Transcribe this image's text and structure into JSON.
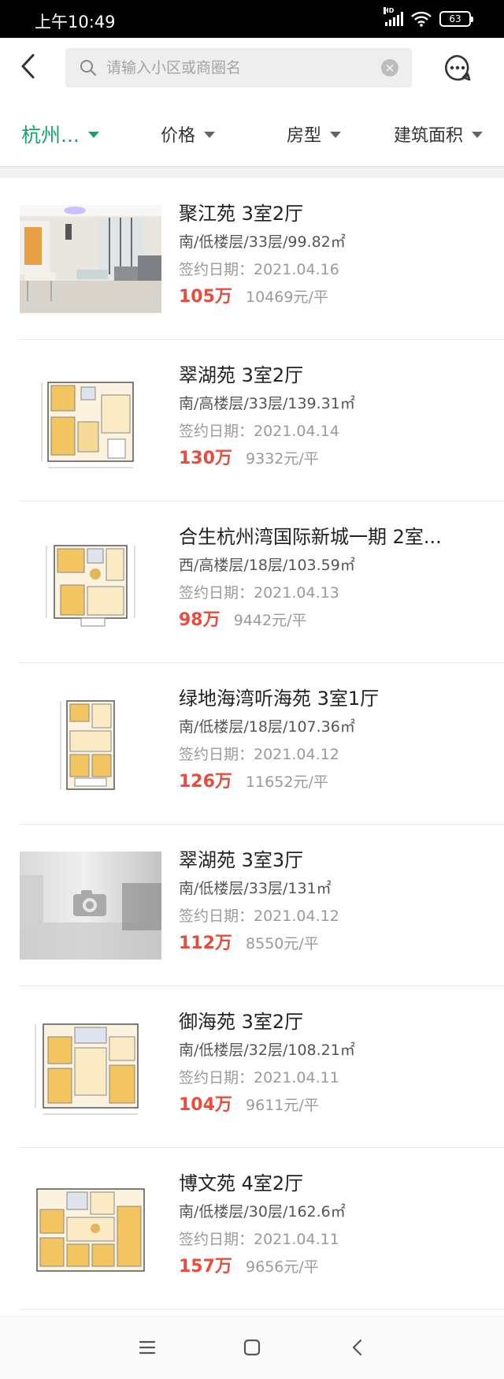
{
  "status_bar": {
    "time": "上午10:49",
    "hd": "HD",
    "battery": "63"
  },
  "search": {
    "placeholder": "请输入小区或商圈名"
  },
  "filters": [
    {
      "label": "杭州...",
      "active": true
    },
    {
      "label": "价格",
      "active": false
    },
    {
      "label": "房型",
      "active": false
    },
    {
      "label": "建筑面积",
      "active": false
    }
  ],
  "listings": [
    {
      "title": "聚江苑 3室2厅",
      "meta": "南/低楼层/33层/99.82㎡",
      "date": "签约日期：2021.04.16",
      "price": "105万",
      "unit_price": "10469元/平",
      "thumb": "photo-room"
    },
    {
      "title": "翠湖苑 3室2厅",
      "meta": "南/高楼层/33层/139.31㎡",
      "date": "签约日期：2021.04.14",
      "price": "130万",
      "unit_price": "9332元/平",
      "thumb": "floorplan"
    },
    {
      "title": "合生杭州湾国际新城一期 2室...",
      "meta": "西/高楼层/18层/103.59㎡",
      "date": "签约日期：2021.04.13",
      "price": "98万",
      "unit_price": "9442元/平",
      "thumb": "floorplan"
    },
    {
      "title": "绿地海湾听海苑 3室1厅",
      "meta": "南/低楼层/18层/107.36㎡",
      "date": "签约日期：2021.04.12",
      "price": "126万",
      "unit_price": "11652元/平",
      "thumb": "floorplan-narrow"
    },
    {
      "title": "翠湖苑 3室3厅",
      "meta": "南/低楼层/33层/131㎡",
      "date": "签约日期：2021.04.12",
      "price": "112万",
      "unit_price": "8550元/平",
      "thumb": "photo-placeholder"
    },
    {
      "title": "御海苑 3室2厅",
      "meta": "南/低楼层/32层/108.21㎡",
      "date": "签约日期：2021.04.11",
      "price": "104万",
      "unit_price": "9611元/平",
      "thumb": "floorplan"
    },
    {
      "title": "博文苑 4室2厅",
      "meta": "南/低楼层/30层/162.6㎡",
      "date": "签约日期：2021.04.11",
      "price": "157万",
      "unit_price": "9656元/平",
      "thumb": "floorplan"
    }
  ],
  "colors": {
    "accent": "#1aa369",
    "price": "#e74c3c"
  },
  "icons": [
    "back-icon",
    "search-icon",
    "clear-icon",
    "message-icon",
    "caret-down-icon",
    "menu-icon",
    "home-icon",
    "nav-back-icon"
  ]
}
